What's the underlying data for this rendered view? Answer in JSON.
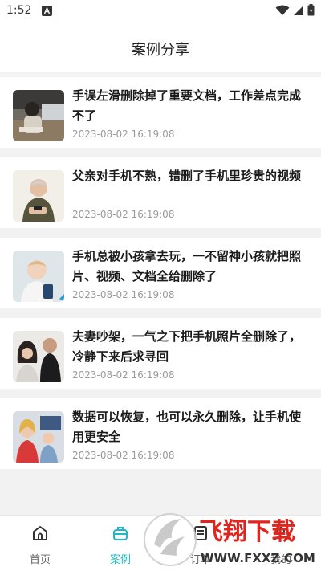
{
  "status_bar": {
    "time": "1:52"
  },
  "header": {
    "title": "案例分享"
  },
  "cases": [
    {
      "title": "手误左滑删除掉了重要文档，工作差点完成不了",
      "time": "2023-08-02 16:19:08"
    },
    {
      "title": "父亲对手机不熟，错删了手机里珍贵的视频",
      "time": "2023-08-02 16:19:08"
    },
    {
      "title": "手机总被小孩拿去玩，一不留神小孩就把照片、视频、文档全给删除了",
      "time": "2023-08-02 16:19:08"
    },
    {
      "title": "夫妻吵架，一气之下把手机照片全删除了，冷静下来后求寻回",
      "time": "2023-08-02 16:19:08"
    },
    {
      "title": "数据可以恢复，也可以永久删除，让手机使用更安全",
      "time": "2023-08-02 16:19:08"
    }
  ],
  "tabs": [
    {
      "label": "首页",
      "icon": "home-icon",
      "active": false
    },
    {
      "label": "案例",
      "icon": "case-icon",
      "active": true
    },
    {
      "label": "订单",
      "icon": "order-icon",
      "active": false
    },
    {
      "label": "我的",
      "icon": "profile-icon",
      "active": false
    }
  ],
  "watermark": {
    "brand": "飞翔下载",
    "url": "WWW.FXXZ.COM"
  },
  "colors": {
    "accent": "#1fb8c4",
    "watermark_red": "#e0251e",
    "background": "#f2f2f2"
  }
}
